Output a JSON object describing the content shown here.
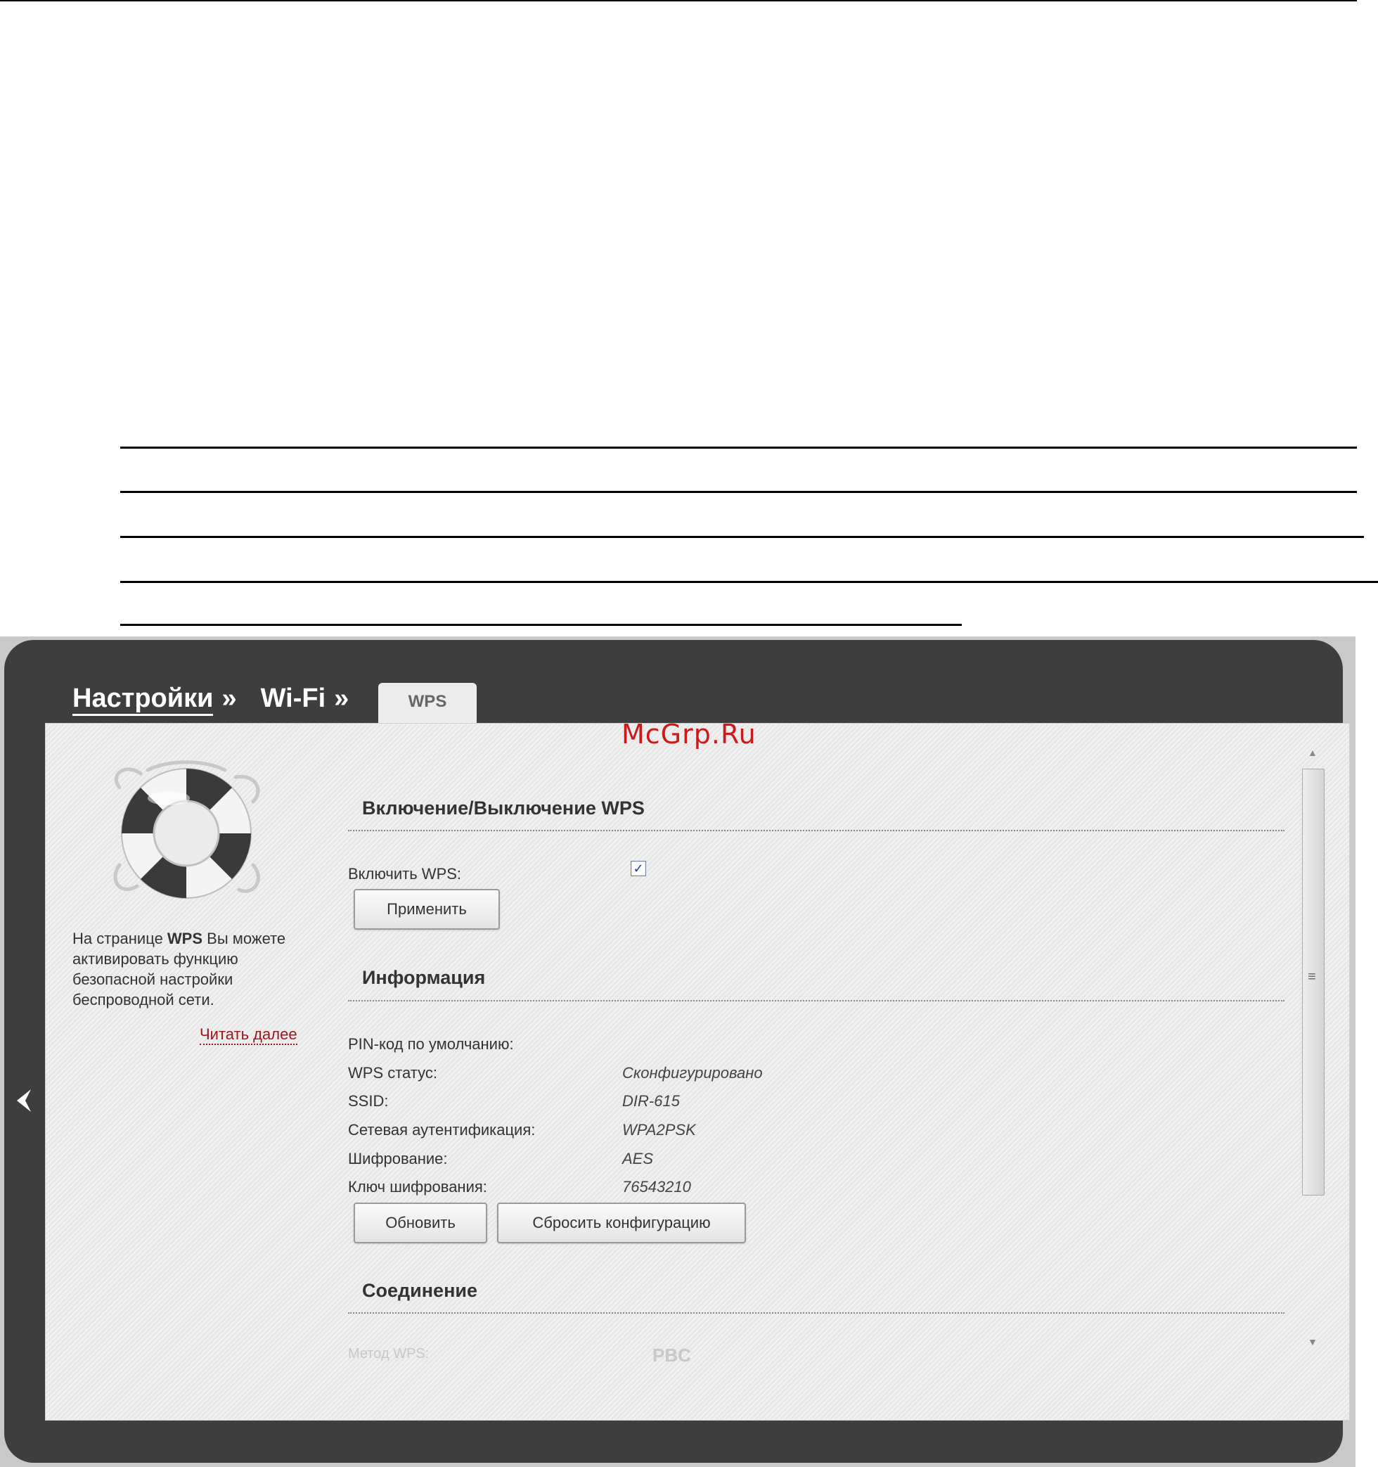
{
  "breadcrumb": {
    "settings": "Настройки",
    "sep1": "»",
    "wifi": "Wi-Fi",
    "sep2": "»"
  },
  "tab": {
    "label": "WPS"
  },
  "watermark": "McGrp.Ru",
  "sidebar": {
    "desc_prefix": "На странице ",
    "desc_bold": "WPS",
    "desc_suffix": " Вы можете активировать функцию безопасной настройки беспроводной сети.",
    "read_more": "Читать далее",
    "icon": "lifebuoy-icon"
  },
  "sections": {
    "wps_toggle": "Включение/Выключение WPS",
    "info": "Информация",
    "connection": "Соединение"
  },
  "wps_toggle": {
    "enable_label": "Включить WPS:",
    "enabled": true,
    "check_glyph": "✓",
    "apply_button": "Применить"
  },
  "info": {
    "rows": [
      {
        "label": "PIN-код по умолчанию:",
        "value": ""
      },
      {
        "label": "WPS статус:",
        "value": "Сконфигурировано"
      },
      {
        "label": "SSID:",
        "value": "DIR-615"
      },
      {
        "label": "Сетевая аутентификация:",
        "value": "WPA2PSK"
      },
      {
        "label": "Шифрование:",
        "value": "AES"
      },
      {
        "label": "Ключ шифрования:",
        "value": "76543210"
      }
    ],
    "refresh_button": "Обновить",
    "reset_button": "Сбросить конфигурацию"
  },
  "connection": {
    "method_label": "Метод WPS:",
    "method_value": "PBC"
  },
  "colors": {
    "frame": "#3e3e3e",
    "panel": "#ebebeb",
    "link_red": "#a0141e",
    "watermark_red": "#cc1a1a"
  }
}
